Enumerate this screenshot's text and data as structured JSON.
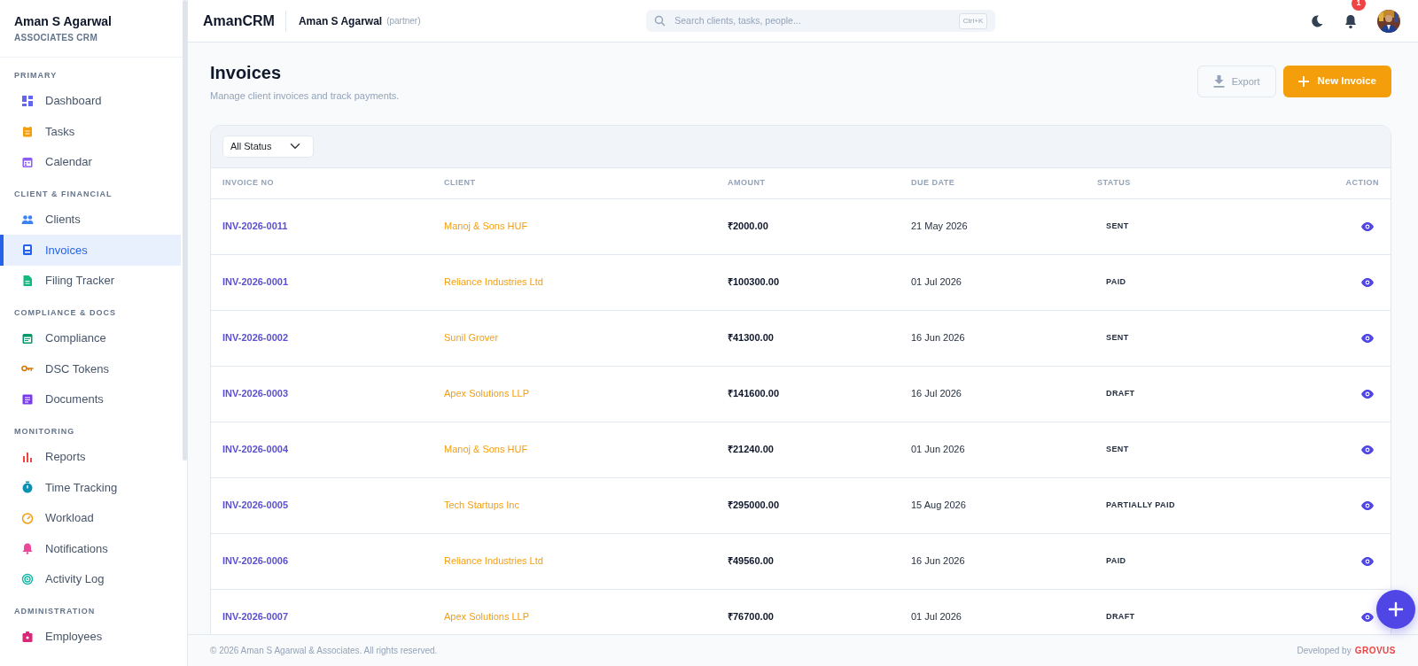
{
  "sidebar": {
    "brand": "Aman S Agarwal",
    "subtitle": "ASSOCIATES CRM",
    "sections": [
      {
        "title": "PRIMARY",
        "items": [
          {
            "label": "Dashboard",
            "color": "#6366f1",
            "selected": false
          },
          {
            "label": "Tasks",
            "color": "#f59e0b",
            "selected": false
          },
          {
            "label": "Calendar",
            "color": "#8b5cf6",
            "selected": false
          }
        ]
      },
      {
        "title": "CLIENT & FINANCIAL",
        "items": [
          {
            "label": "Clients",
            "color": "#3b82f6",
            "selected": false
          },
          {
            "label": "Invoices",
            "color": "#2563eb",
            "selected": true
          },
          {
            "label": "Filing Tracker",
            "color": "#10b981",
            "selected": false
          }
        ]
      },
      {
        "title": "COMPLIANCE & DOCS",
        "items": [
          {
            "label": "Compliance",
            "color": "#059669",
            "selected": false
          },
          {
            "label": "DSC Tokens",
            "color": "#d97706",
            "selected": false
          },
          {
            "label": "Documents",
            "color": "#7c3aed",
            "selected": false
          }
        ]
      },
      {
        "title": "MONITORING",
        "items": [
          {
            "label": "Reports",
            "color": "#ef4444",
            "selected": false
          },
          {
            "label": "Time Tracking",
            "color": "#0891b2",
            "selected": false
          },
          {
            "label": "Workload",
            "color": "#f59e0b",
            "selected": false
          },
          {
            "label": "Notifications",
            "color": "#ec4899",
            "selected": false
          },
          {
            "label": "Activity Log",
            "color": "#14b8a6",
            "selected": false
          }
        ]
      },
      {
        "title": "ADMINISTRATION",
        "items": [
          {
            "label": "Employees",
            "color": "#db2777",
            "selected": false
          }
        ]
      }
    ]
  },
  "header": {
    "app_name": "AmanCRM",
    "user": "Aman S Agarwal",
    "role": "(partner)",
    "search": {
      "placeholder": "Search clients, tasks, people...",
      "shortcut": "Ctrl+K"
    },
    "notification_count": "1"
  },
  "page": {
    "title": "Invoices",
    "subtitle": "Manage client invoices and track payments.",
    "export_button": "Export",
    "new_button": "New Invoice"
  },
  "filter": {
    "value": "All Status"
  },
  "table": {
    "columns": [
      "INVOICE NO",
      "CLIENT",
      "AMOUNT",
      "DUE DATE",
      "STATUS",
      "ACTION"
    ],
    "rows": [
      {
        "invoice_no": "INV-2026-0011",
        "client": "Manoj & Sons HUF",
        "amount": "₹2000.00",
        "due_date": "21 May 2026",
        "status": "SENT"
      },
      {
        "invoice_no": "INV-2026-0001",
        "client": "Reliance Industries Ltd",
        "amount": "₹100300.00",
        "due_date": "01 Jul 2026",
        "status": "PAID"
      },
      {
        "invoice_no": "INV-2026-0002",
        "client": "Sunil Grover",
        "amount": "₹41300.00",
        "due_date": "16 Jun 2026",
        "status": "SENT"
      },
      {
        "invoice_no": "INV-2026-0003",
        "client": "Apex Solutions LLP",
        "amount": "₹141600.00",
        "due_date": "16 Jul 2026",
        "status": "DRAFT"
      },
      {
        "invoice_no": "INV-2026-0004",
        "client": "Manoj & Sons HUF",
        "amount": "₹21240.00",
        "due_date": "01 Jun 2026",
        "status": "SENT"
      },
      {
        "invoice_no": "INV-2026-0005",
        "client": "Tech Startups Inc",
        "amount": "₹295000.00",
        "due_date": "15 Aug 2026",
        "status": "PARTIALLY PAID"
      },
      {
        "invoice_no": "INV-2026-0006",
        "client": "Reliance Industries Ltd",
        "amount": "₹49560.00",
        "due_date": "16 Jun 2026",
        "status": "PAID"
      },
      {
        "invoice_no": "INV-2026-0007",
        "client": "Apex Solutions LLP",
        "amount": "₹76700.00",
        "due_date": "01 Jul 2026",
        "status": "DRAFT"
      }
    ]
  },
  "footer": {
    "copyright": "© 2026 Aman S Agarwal & Associates. All rights reserved.",
    "developed_by": "Developed by",
    "developer_logo": "GROVUS"
  }
}
